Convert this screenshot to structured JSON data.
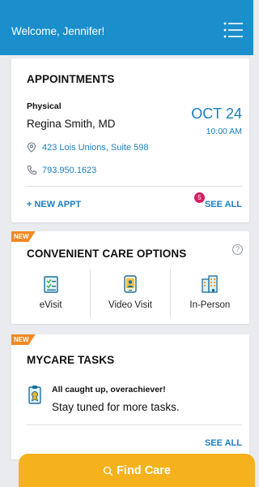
{
  "header": {
    "welcome": "Welcome, Jennifer!",
    "menu_icon": "menu-list-icon",
    "background": "#1a8fcc"
  },
  "appointments": {
    "title": "APPOINTMENTS",
    "type": "Physical",
    "doctor": "Regina Smith, MD",
    "date": "OCT 24",
    "time": "10:00 AM",
    "address": "423 Lois Unions, Suite 598",
    "phone": "793.950.1623",
    "new_appt_label": "+ NEW APPT",
    "see_all_label": "SEE ALL",
    "badge_count": "5"
  },
  "care_options": {
    "new_tag": "NEW",
    "title": "CONVENIENT CARE OPTIONS",
    "help_label": "?",
    "options": [
      {
        "label": "eVisit",
        "icon": "clipboard-check-icon"
      },
      {
        "label": "Video Visit",
        "icon": "mobile-video-icon"
      },
      {
        "label": "In-Person",
        "icon": "building-icon"
      }
    ]
  },
  "tasks": {
    "new_tag": "NEW",
    "title": "MYCARE TASKS",
    "status_title": "All caught up, overachiever!",
    "status_sub": "Stay tuned for more tasks.",
    "see_all_label": "SEE ALL"
  },
  "find_care": {
    "label": "Find Care",
    "color": "#f5b21c"
  },
  "colors": {
    "accent_blue": "#1a7fbf",
    "new_tag": "#f08a24",
    "badge": "#d81b60"
  }
}
